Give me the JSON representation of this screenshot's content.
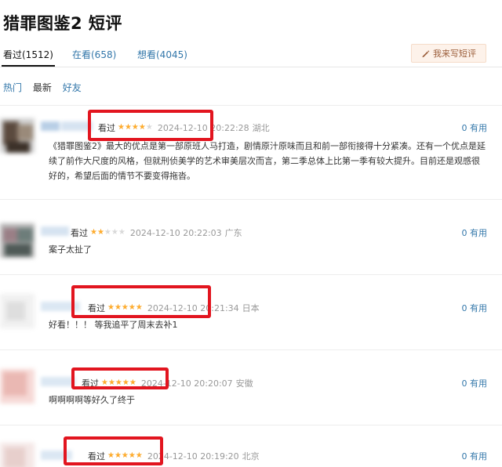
{
  "page": {
    "title": "猎罪图鉴2 短评"
  },
  "tabs": [
    {
      "label": "看过(1512)",
      "active": true
    },
    {
      "label": "在看(658)",
      "active": false
    },
    {
      "label": "想看(4045)",
      "active": false
    }
  ],
  "write_button": {
    "label": "我来写短评",
    "icon": "pencil-icon"
  },
  "sort_options": [
    "热门",
    "最新",
    "好友"
  ],
  "comments": [
    {
      "status": "看过",
      "rating": 4,
      "stars": "★★★★★",
      "time": "2024-12-10 20:22:28",
      "location": "湖北",
      "useful": "0 有用",
      "text": "《猎罪图鉴2》最大的优点是第一部原班人马打造，剧情原汁原味而且和前一部衔接得十分紧凑。还有一个优点是延续了前作大尺度的风格，但就刑侦美学的艺术审美层次而言，第二季总体上比第一季有较大提升。目前还是观感很好的，希望后面的情节不要变得拖沓。"
    },
    {
      "status": "看过",
      "rating": 2,
      "stars": "★★★★★",
      "time": "2024-12-10 20:22:03",
      "location": "广东",
      "useful": "0 有用",
      "text": "案子太扯了"
    },
    {
      "status": "看过",
      "rating": 5,
      "stars": "★★★★★",
      "time": "2024-12-10 20:21:34",
      "location": "日本",
      "useful": "0 有用",
      "text": "好看！！！ 等我追平了周末去补1"
    },
    {
      "status": "看过",
      "rating": 5,
      "stars": "★★★★★",
      "time": "2024-12-10 20:20:07",
      "location": "安徽",
      "useful": "0 有用",
      "text": "啊啊啊啊等好久了终于"
    },
    {
      "status": "看过",
      "rating": 5,
      "stars": "★★★★★",
      "time": "2024-12-10 20:19:20",
      "location": "北京",
      "useful": "0 有用",
      "text": ""
    }
  ],
  "colors": {
    "link": "#3377aa",
    "star": "#ffac2d",
    "highlight_box": "#e2151f",
    "write_button_bg": "#fdf2ea"
  }
}
